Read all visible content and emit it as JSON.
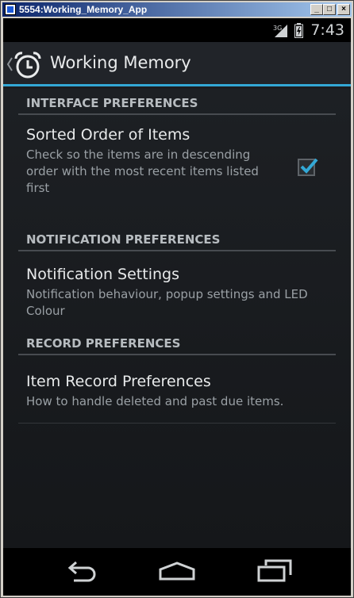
{
  "window": {
    "title": "5554:Working_Memory_App",
    "min_label": "_",
    "max_label": "□",
    "close_label": "×"
  },
  "status_bar": {
    "time": "7:43",
    "network": "3G"
  },
  "action_bar": {
    "title": "Working Memory",
    "accent_color": "#33a8d6"
  },
  "sections": [
    {
      "header": "INTERFACE PREFERENCES",
      "items": [
        {
          "title": "Sorted Order of Items",
          "summary": "Check so the items are in descending order with the most recent items listed first",
          "checked": true
        }
      ]
    },
    {
      "header": "NOTIFICATION PREFERENCES",
      "items": [
        {
          "title": "Notification Settings",
          "summary": "Notification behaviour, popup settings and LED Colour"
        }
      ]
    },
    {
      "header": "RECORD PREFERENCES",
      "items": [
        {
          "title": "Item Record Preferences",
          "summary": "How to handle deleted and past due items."
        }
      ]
    }
  ],
  "nav_bar": {
    "icons": [
      "back-icon",
      "home-icon",
      "recents-icon"
    ]
  }
}
